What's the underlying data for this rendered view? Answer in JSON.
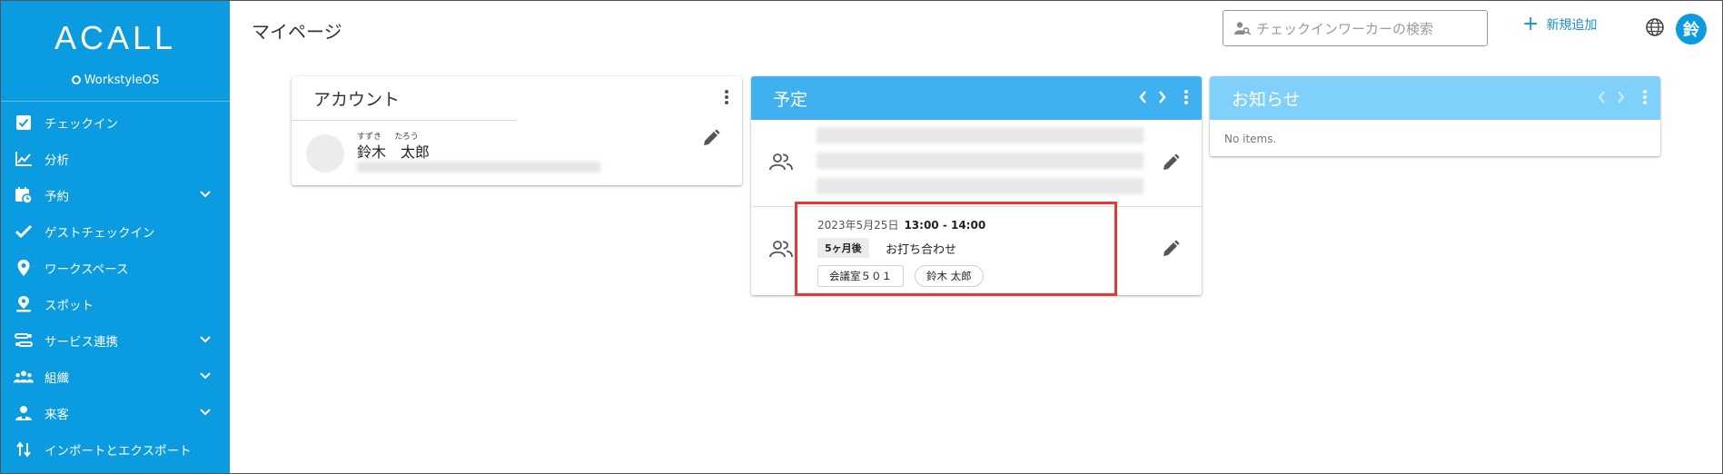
{
  "app": {
    "logo": "ACALL",
    "brand": "WorkstyleOS",
    "accent": "#0a9be0"
  },
  "sidebar": {
    "items": [
      {
        "label": "チェックイン",
        "icon": "checkbox-icon"
      },
      {
        "label": "分析",
        "icon": "chart-icon"
      },
      {
        "label": "予約",
        "icon": "calendar-icon",
        "expandable": true
      },
      {
        "label": "ゲストチェックイン",
        "icon": "check-icon"
      },
      {
        "label": "ワークスペース",
        "icon": "location-pin-icon"
      },
      {
        "label": "スポット",
        "icon": "spot-pin-icon"
      },
      {
        "label": "サービス連携",
        "icon": "integration-icon",
        "expandable": true
      },
      {
        "label": "組織",
        "icon": "people-icon",
        "expandable": true
      },
      {
        "label": "来客",
        "icon": "visitor-icon",
        "expandable": true
      },
      {
        "label": "インポートとエクスポート",
        "icon": "import-export-icon"
      }
    ]
  },
  "header": {
    "title": "マイページ",
    "search_placeholder": "チェックインワーカーの検索",
    "add_new": "新規追加",
    "avatar_initial": "鈴"
  },
  "account": {
    "title": "アカウント",
    "ruby_family": "すずき",
    "ruby_given": "たろう",
    "name": "鈴木　太郎"
  },
  "schedule": {
    "title": "予定",
    "date": "2023年5月25日",
    "time": "13:00 - 14:00",
    "relative": "5ヶ月後",
    "meeting": "お打ち合わせ",
    "room": "会議室５０１",
    "attendee": "鈴木 太郎"
  },
  "notice": {
    "title": "お知らせ",
    "empty": "No items."
  }
}
